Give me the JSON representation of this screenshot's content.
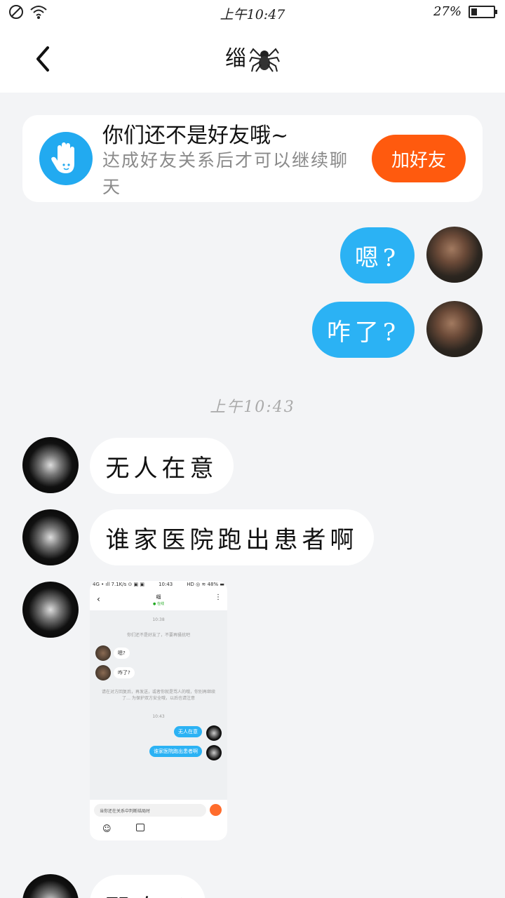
{
  "status_bar": {
    "time": "上午10:47",
    "battery": "27%",
    "battery_level": 0.27
  },
  "header": {
    "title": "缁",
    "title_icon": "spider-emoji-icon"
  },
  "notice": {
    "headline": "你们还不是好友哦~",
    "subtext": "达成好友关系后才可以继续聊天",
    "add_friend_label": "加好友"
  },
  "messages_out": [
    {
      "text": "嗯?"
    },
    {
      "text": "咋了?"
    }
  ],
  "timestamp": "上午10:43",
  "messages_in": [
    {
      "text": "无人在意"
    },
    {
      "text": "谁家医院跑出患者啊"
    },
    {
      "text": "那咋了"
    }
  ],
  "screenshot_thumb": {
    "status_left": "4G • ıll 7.1K/s ⊙ ▣ ▣",
    "status_time": "10:43",
    "status_right": "HD ◎ ≋ 48% ▬",
    "title": "缁",
    "subtitle": "● 在线",
    "time1": "10:38",
    "system_line": "你们还不是好友了，不要再骚扰吧",
    "msg1": "嗯?",
    "msg2": "咋了?",
    "note": "请在对方回复后，再发送，或者你就是骂人的哦，你别再继续了… 为保护双方安全哦，以后也请注意",
    "time2": "10:43",
    "out1": "无人在意",
    "out2": "谁家医院跑出患者啊",
    "input_text": "当你还在关系中判断结局时",
    "emoji_icon": "emoji-face-icon",
    "image_icon": "image-icon"
  }
}
